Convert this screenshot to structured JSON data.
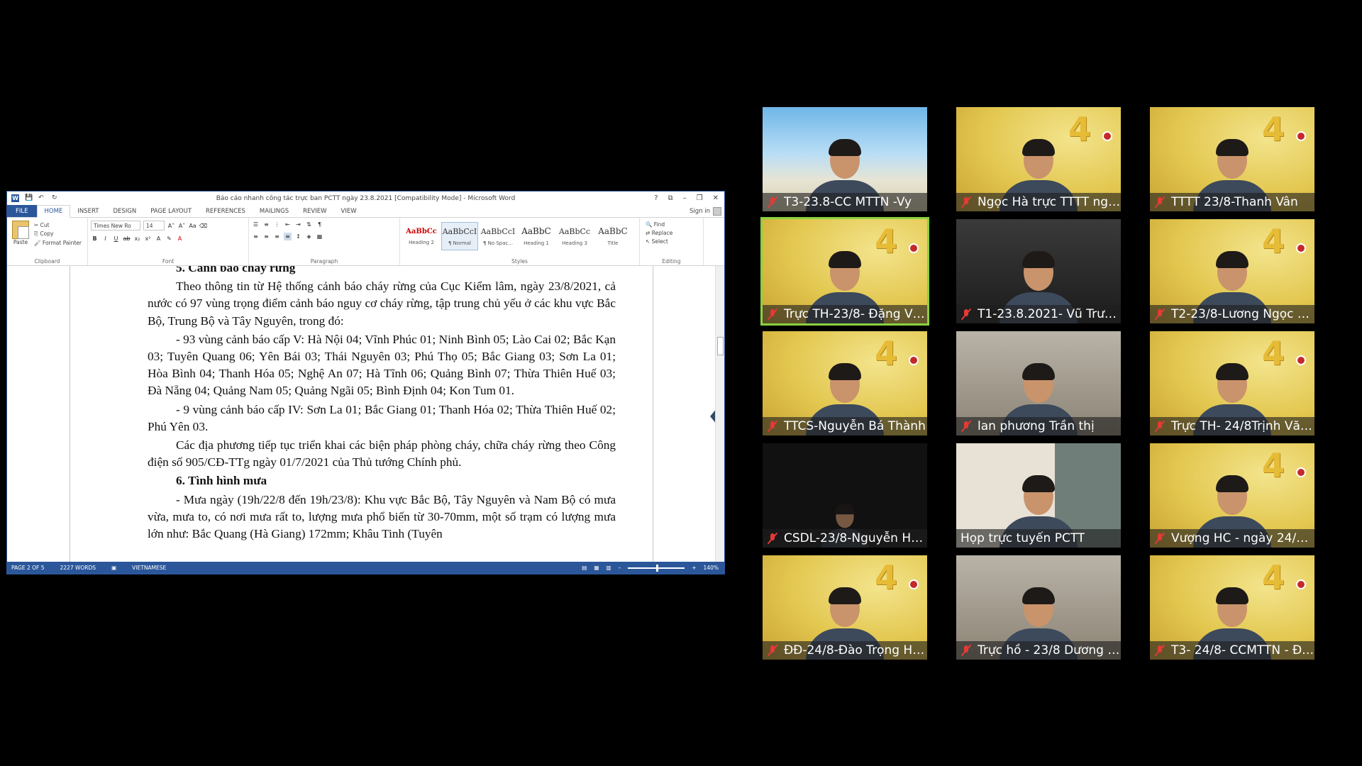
{
  "word": {
    "title": "Báo cáo nhanh công tác trực ban PCTT ngày 23.8.2021 [Compatibility Mode] - Microsoft Word",
    "winbtns": [
      "?",
      "⧉",
      "–",
      "❐",
      "✕"
    ],
    "tabs": [
      "FILE",
      "HOME",
      "INSERT",
      "DESIGN",
      "PAGE LAYOUT",
      "REFERENCES",
      "MAILINGS",
      "REVIEW",
      "VIEW"
    ],
    "sign_in": "Sign in",
    "clipboard": {
      "paste": "Paste",
      "cut": "Cut",
      "copy": "Copy",
      "format_painter": "Format Painter",
      "label": "Clipboard"
    },
    "font": {
      "name": "Times New Ro",
      "size": "14",
      "label": "Font"
    },
    "paragraph": {
      "label": "Paragraph"
    },
    "styles": {
      "label": "Styles",
      "items": [
        {
          "preview": "AaBbCc",
          "name": "Heading 2"
        },
        {
          "preview": "AaBbCcI",
          "name": "¶ Normal"
        },
        {
          "preview": "AaBbCcI",
          "name": "¶ No Spac..."
        },
        {
          "preview": "AaBbC",
          "name": "Heading 1"
        },
        {
          "preview": "AaBbCc",
          "name": "Heading 3"
        },
        {
          "preview": "AaBbC",
          "name": "Title"
        }
      ]
    },
    "editing": {
      "find": "Find",
      "replace": "Replace",
      "select": "Select",
      "label": "Editing"
    },
    "doc": {
      "heading5": "5. Cảnh báo cháy rừng",
      "p1": "Theo thông tin từ Hệ thống cảnh báo cháy rừng của Cục Kiểm lâm, ngày 23/8/2021, cả nước có 97 vùng trọng điểm cảnh báo nguy cơ cháy rừng, tập trung chủ yếu ở các khu vực Bắc Bộ, Trung Bộ và Tây Nguyên, trong đó:",
      "p2": "- 93 vùng cảnh báo cấp V: Hà Nội 04; Vĩnh Phúc 01; Ninh Bình 05; Lào Cai 02; Bắc Kạn 03; Tuyên Quang 06; Yên Bái 03; Thái Nguyên 03; Phú Thọ 05; Bắc Giang 03; Sơn La 01; Hòa Bình 04; Thanh Hóa 05; Nghệ An 07; Hà Tĩnh 06; Quảng Bình 07; Thừa Thiên Huế 03; Đà Nẵng 04; Quảng Nam 05; Quảng Ngãi 05; Bình Định 04; Kon Tum 01.",
      "p3": "- 9 vùng cảnh báo cấp IV: Sơn La 01; Bắc Giang 01; Thanh Hóa 02; Thừa Thiên Huế 02; Phú Yên 03.",
      "p4": "Các địa phương tiếp tục triển khai các biện pháp phòng cháy, chữa cháy rừng theo Công điện số 905/CĐ-TTg ngày 01/7/2021 của Thủ tướng Chính phủ.",
      "heading6": "6. Tình hình mưa",
      "p5": "- Mưa ngày (19h/22/8 đến 19h/23/8): Khu vực Bắc Bộ, Tây Nguyên và Nam Bộ có mưa vừa, mưa to, có nơi mưa rất to, lượng mưa phổ biến từ 30-70mm, một số trạm có lượng mưa lớn như: Bắc Quang (Hà Giang) 172mm; Khâu Tinh (Tuyên"
    },
    "status": {
      "page": "PAGE 2 OF 5",
      "words": "2227 WORDS",
      "language": "VIETNAMESE",
      "zoom": "140%"
    }
  },
  "participants": [
    {
      "name": "T3-23.8-CC MTTN -Vy",
      "bg": "beach"
    },
    {
      "name": "Ngọc Hà trực TTTT ngày ...",
      "bg": "yellow"
    },
    {
      "name": "TTTT 23/8-Thanh Vân",
      "bg": "yellow"
    },
    {
      "name": "Trực TH-23/8- Đặng Văn Đăng",
      "bg": "yellow",
      "speaking": true
    },
    {
      "name": "T1-23.8.2021- Vũ Trường ...",
      "bg": "dark"
    },
    {
      "name": "T2-23/8-Lương Ngọc Khá...",
      "bg": "yellow"
    },
    {
      "name": "TTCS-Nguyễn Bá Thành",
      "bg": "yellow"
    },
    {
      "name": "lan phương Trần thị",
      "bg": "room"
    },
    {
      "name": "Trực TH- 24/8Trịnh Văn K...",
      "bg": "yellow"
    },
    {
      "name": "CSDL-23/8-Nguyễn Hữu ...",
      "bg": "black"
    },
    {
      "name": "Họp trực tuyến PCTT",
      "bg": "office"
    },
    {
      "name": "Vượng HC - ngày 24/8/20...",
      "bg": "yellow"
    },
    {
      "name": "ĐĐ-24/8-Đào Trọng Hậu",
      "bg": "yellow"
    },
    {
      "name": "Trực hồ - 23/8 Dương Đứ...",
      "bg": "room"
    },
    {
      "name": "T3- 24/8- CCMTTN - Đặn...",
      "bg": "yellow"
    }
  ]
}
